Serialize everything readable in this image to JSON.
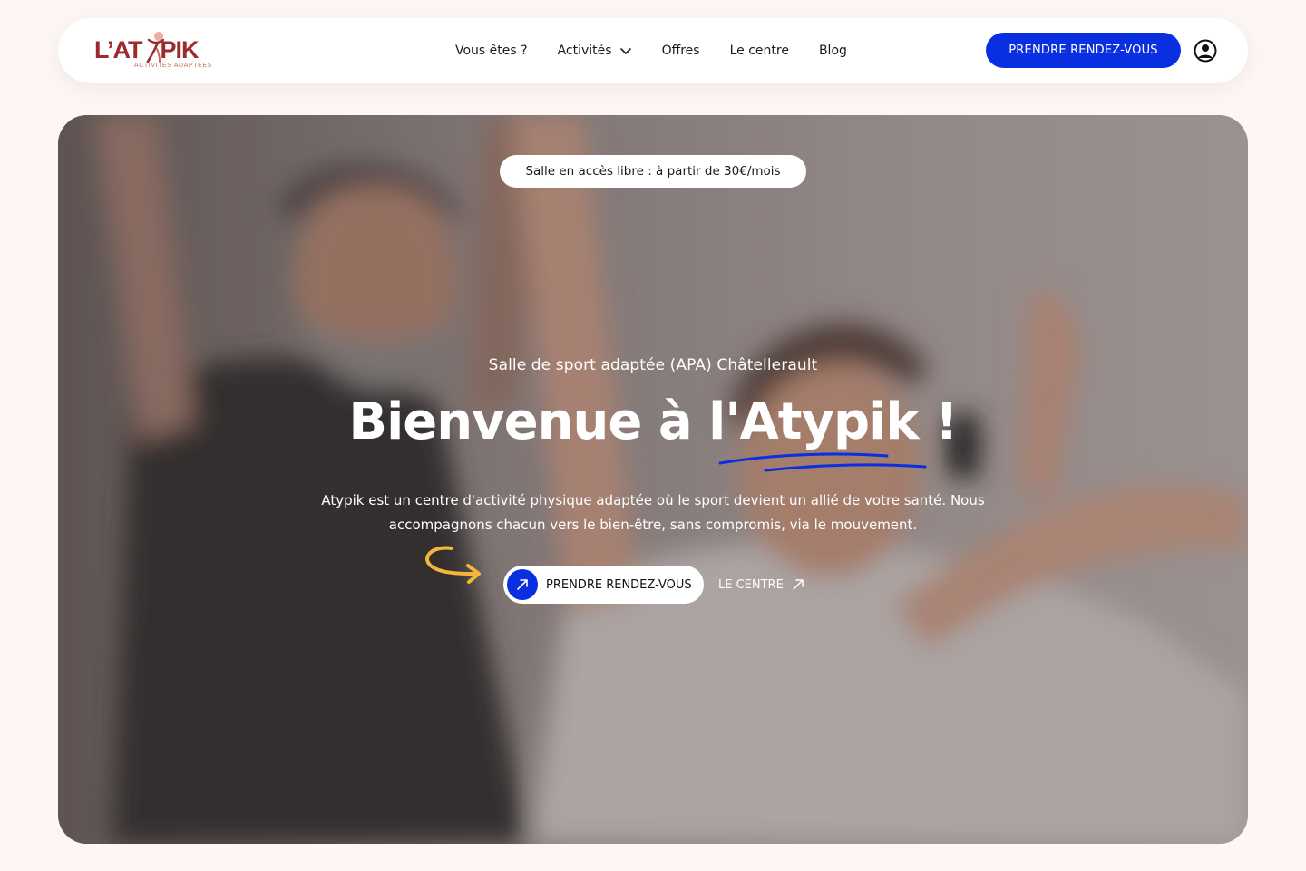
{
  "header": {
    "logo": {
      "wordmark": "L'ATYPIK",
      "tagline": "ACTIVITÉS ADAPTÉES"
    },
    "nav": [
      {
        "label": "Vous êtes ?"
      },
      {
        "label": "Activités",
        "has_dropdown": true
      },
      {
        "label": "Offres"
      },
      {
        "label": "Le centre"
      },
      {
        "label": "Blog"
      }
    ],
    "cta_label": "PRENDRE RENDEZ-VOUS",
    "account_icon": "user-circle-icon"
  },
  "hero": {
    "badge": "Salle en accès libre : à partir de 30€/mois",
    "subtitle": "Salle de sport adaptée (APA)  Châtellerault",
    "title": "Bienvenue à l'Atypik !",
    "description": "Atypik est un centre d'activité physique adaptée où le sport devient un allié de votre santé. Nous accompagnons chacun vers le bien-être, sans compromis, via le mouvement.",
    "primary_cta": "PRENDRE RENDEZ-VOUS",
    "secondary_cta": "LE CENTRE"
  },
  "colors": {
    "brand_red": "#9c2b2f",
    "accent_blue": "#0a2fe0",
    "accent_yellow": "#f4b63a",
    "page_bg": "#fdf6f4"
  }
}
